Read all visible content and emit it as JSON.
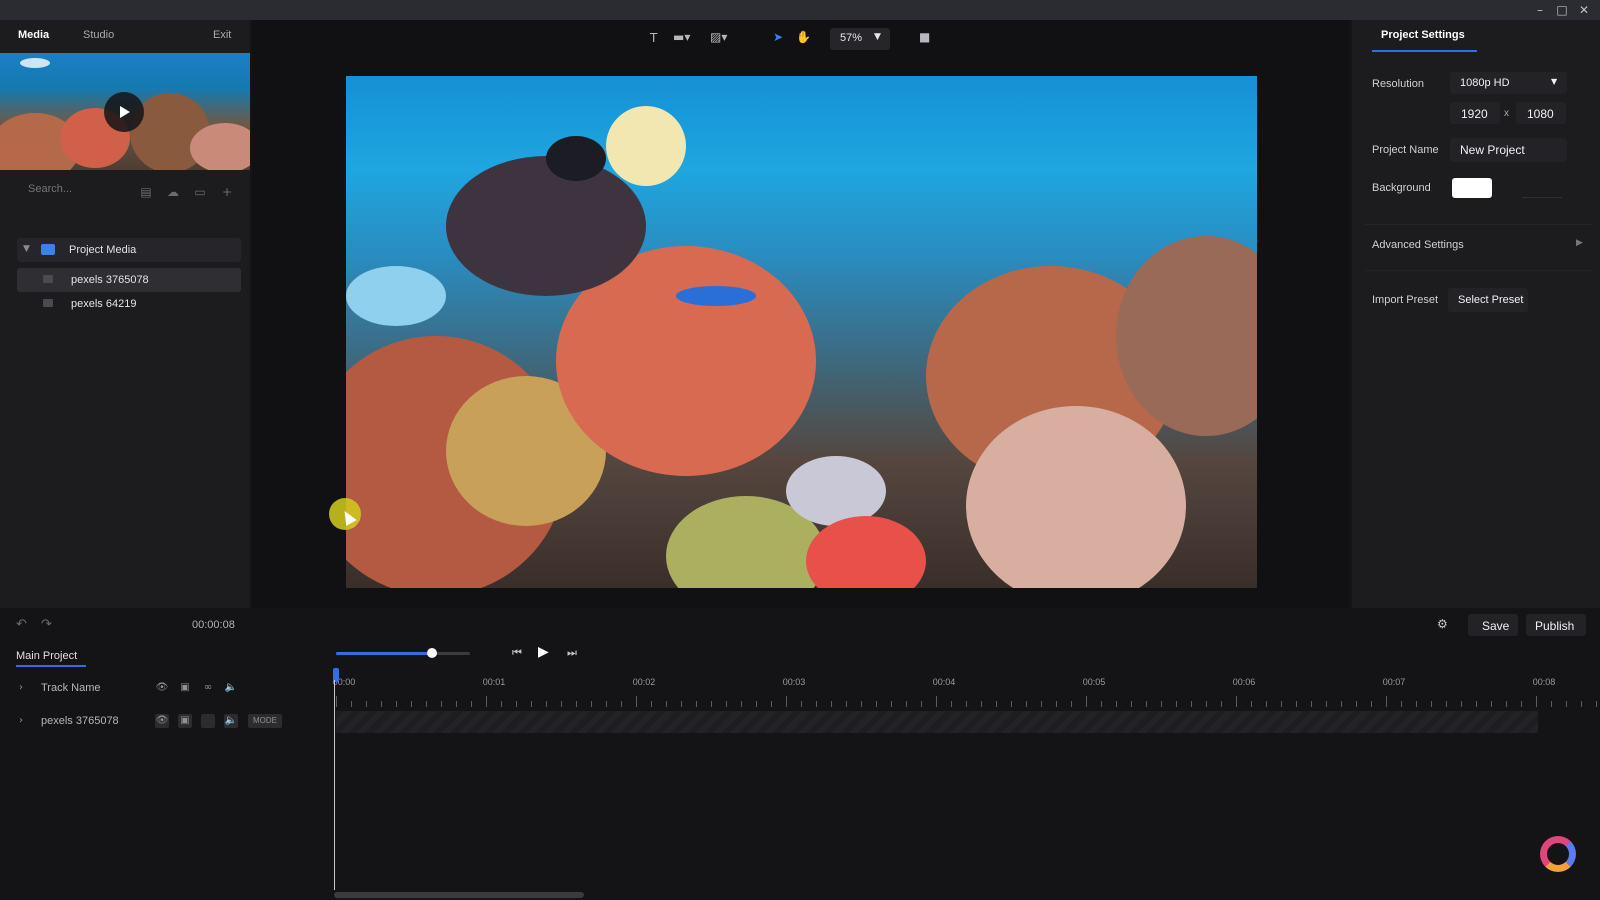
{
  "window": {
    "minimize_icon": "minimize-icon",
    "maximize_icon": "maximize-icon",
    "close_icon": "close-icon"
  },
  "nav": {
    "media": "Media",
    "studio": "Studio",
    "exit": "Exit"
  },
  "media_panel": {
    "search_placeholder": "Search...",
    "tools": [
      "note-icon",
      "upload-icon",
      "folder-icon",
      "add-icon"
    ],
    "folder_label": "Project Media",
    "items": [
      {
        "label": "pexels 3765078",
        "selected": true
      },
      {
        "label": "pexels 64219",
        "selected": false
      }
    ]
  },
  "toolbar": {
    "text_tool": "T",
    "zoom": "57%",
    "icons": [
      "text-icon",
      "shape-icon",
      "image-icon",
      "pointer-icon",
      "hand-icon",
      "zoom-dropdown-icon",
      "camera-icon"
    ]
  },
  "project_settings": {
    "tab": "Project Settings",
    "resolution_label": "Resolution",
    "resolution_value": "1080p HD",
    "width": "1920",
    "times": "x",
    "height": "1080",
    "name_label": "Project Name",
    "name_value": "New Project",
    "background_label": "Background",
    "background_color": "#ffffff",
    "advanced_label": "Advanced Settings",
    "import_label": "Import Preset",
    "preset_button": "Select Preset"
  },
  "playback": {
    "timecode": "00:00:08",
    "settings_icon": "gear-icon",
    "save": "Save",
    "publish": "Publish",
    "progress": 0.72
  },
  "timeline": {
    "tab": "Main Project",
    "ticks": [
      "00:00",
      "00:01",
      "00:02",
      "00:03",
      "00:04",
      "00:05",
      "00:06",
      "00:07",
      "00:08"
    ],
    "tracks": [
      {
        "name": "Track Name"
      },
      {
        "name": "pexels 3765078",
        "mode": "MODE"
      }
    ]
  },
  "brand": {
    "accent": "#2f6fe0",
    "logo_icon": "app-logo-icon"
  }
}
